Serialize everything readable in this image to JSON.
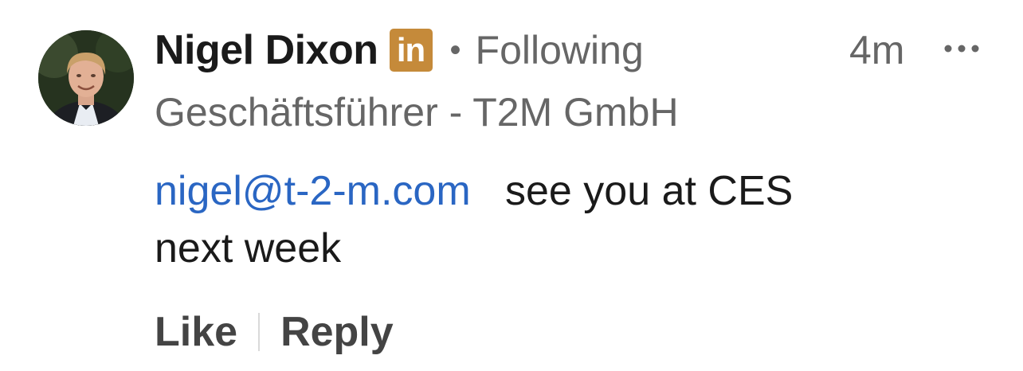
{
  "comment": {
    "author": {
      "name": "Nigel Dixon",
      "badge_icon": "linkedin-icon",
      "badge_label": "in",
      "badge_color": "#c58a3a",
      "separator": "•",
      "follow_status": "Following",
      "headline": "Geschäftsführer - T2M GmbH"
    },
    "timestamp": "4m",
    "more_icon": "more-options-icon",
    "body": {
      "mention": "nigel@t-2-m.com",
      "text_first_line": "see you at CES",
      "text_second_line": "next week"
    },
    "actions": {
      "like_label": "Like",
      "reply_label": "Reply"
    },
    "colors": {
      "link": "#2a66c3",
      "secondary_text": "#666666",
      "primary_text": "#1a1a1a"
    }
  }
}
